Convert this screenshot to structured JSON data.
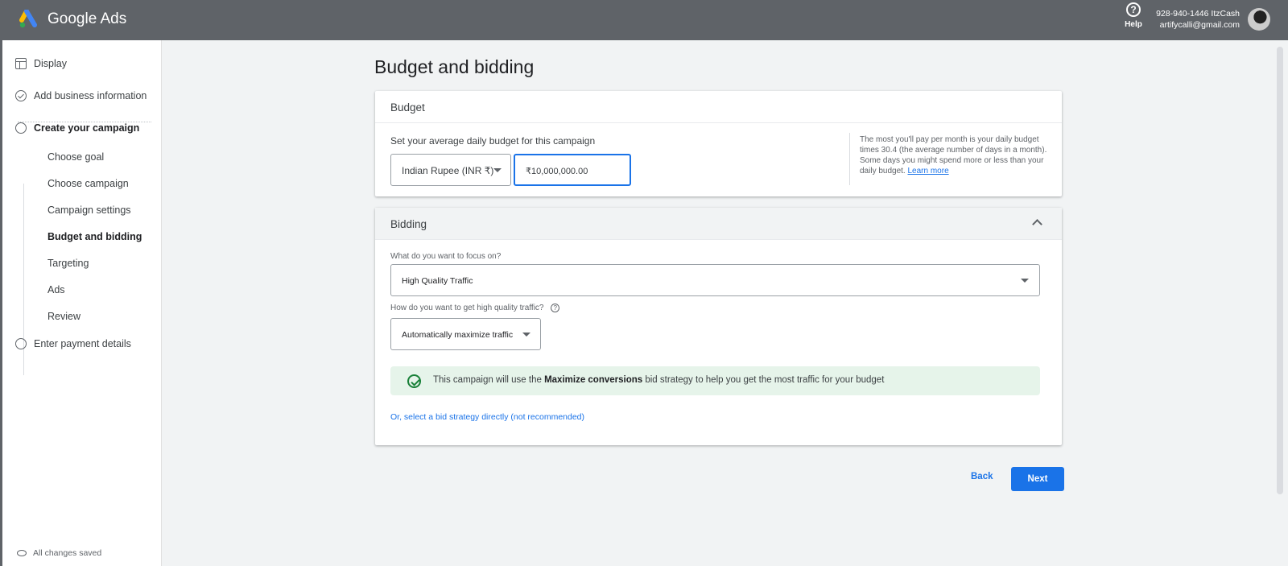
{
  "header": {
    "brand": "Google Ads",
    "help_label": "Help",
    "account_line1": "928-940-1446 ItzCash",
    "account_line2": "artifycalli@gmail.com"
  },
  "sidebar": {
    "display": "Display",
    "add_business": "Add business information",
    "create_campaign": "Create your campaign",
    "steps": [
      "Choose goal",
      "Choose campaign",
      "Campaign settings",
      "Budget and bidding",
      "Targeting",
      "Ads",
      "Review"
    ],
    "active_step": "Budget and bidding",
    "enter_payment": "Enter payment details",
    "saved_status": "All changes saved"
  },
  "main": {
    "title": "Budget and bidding",
    "budget": {
      "heading": "Budget",
      "question": "Set your average daily budget for this campaign",
      "currency": "Indian Rupee (INR ₹)",
      "amount": "₹10,000,000.00",
      "info_text": "The most you'll pay per month is your daily budget times 30.4 (the average number of days in a month). Some days you might spend more or less than your daily budget.",
      "learn_more": "Learn more"
    },
    "bidding": {
      "heading": "Bidding",
      "focus_label": "What do you want to focus on?",
      "focus_value": "High Quality Traffic",
      "how_label": "How do you want to get high quality traffic?",
      "how_value": "Automatically maximize traffic",
      "banner_prefix": "This campaign will use the",
      "banner_bold": "Maximize conversions",
      "banner_suffix": "bid strategy to help you get the most traffic for your budget",
      "direct_link": "Or, select a bid strategy directly (not recommended)"
    },
    "back_label": "Back",
    "next_label": "Next"
  },
  "colors": {
    "header_bg": "#5f6368",
    "accent": "#1a73e8",
    "success_bg": "#e6f4ea",
    "success": "#188038"
  }
}
